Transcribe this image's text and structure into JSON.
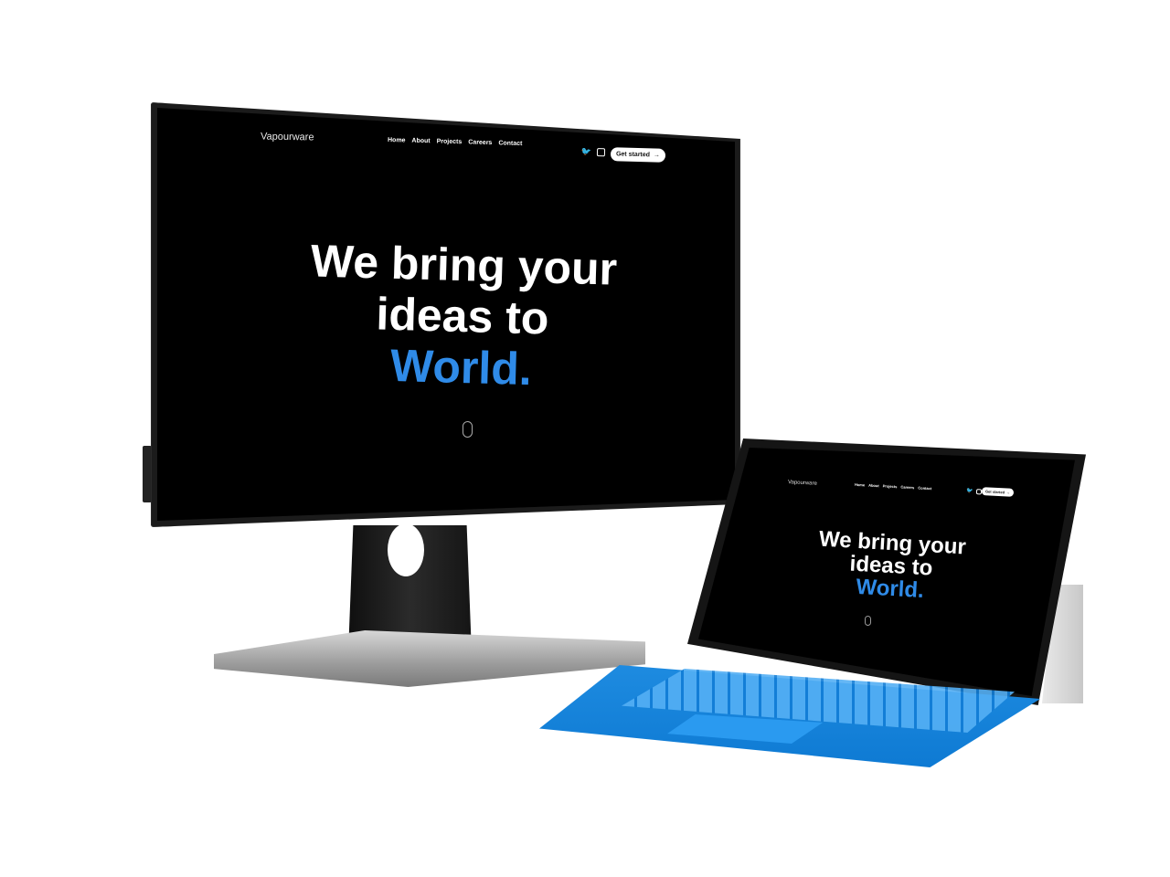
{
  "website": {
    "logo": "Vapourware",
    "nav": [
      "Home",
      "About",
      "Projects",
      "Careers",
      "Contact"
    ],
    "social": [
      "twitter-icon",
      "instagram-icon"
    ],
    "cta_label": "Get started",
    "cta_arrow": "→",
    "hero_line1": "We bring your",
    "hero_line2": "ideas to",
    "hero_accent": "World.",
    "accent_color": "#2f8be8",
    "background_color": "#000000",
    "scroll_indicator": "mouse-scroll-icon"
  },
  "devices": [
    "monitor",
    "tablet"
  ],
  "keyboard_color": "#1e8be0"
}
